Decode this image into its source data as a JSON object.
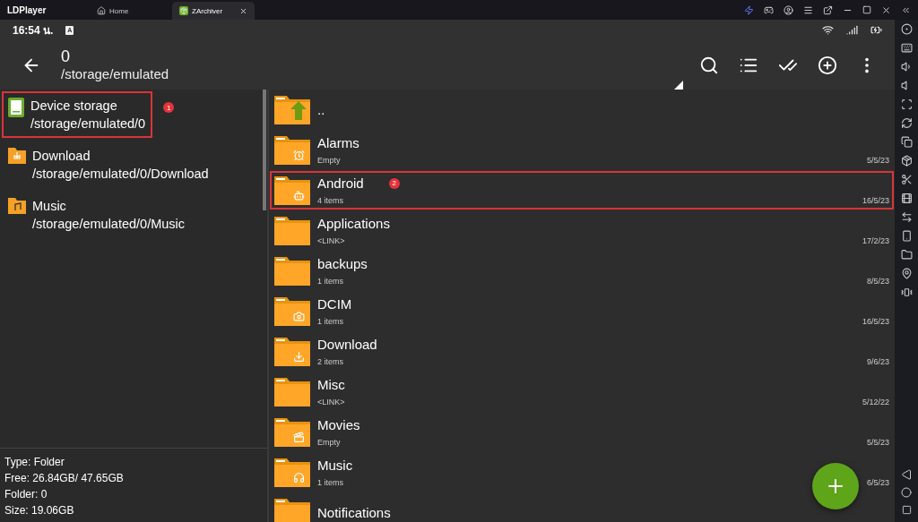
{
  "emulator": {
    "brand": "LDPlayer",
    "tabs": [
      {
        "label": "Home",
        "selected": false,
        "closable": false
      },
      {
        "label": "ZArchiver",
        "selected": true,
        "closable": true
      }
    ]
  },
  "status_bar": {
    "time": "16:54 น.",
    "notification": "A"
  },
  "toolbar": {
    "title": "0",
    "path": "/storage/emulated"
  },
  "sidebar": {
    "items": [
      {
        "kind": "storage",
        "name": "Device storage",
        "path": "/storage/emulated/0",
        "highlighted": true,
        "marker": "1"
      },
      {
        "kind": "download",
        "name": "Download",
        "path": "/storage/emulated/0/Download",
        "highlighted": false
      },
      {
        "kind": "music",
        "name": "Music",
        "path": "/storage/emulated/0/Music",
        "highlighted": false
      }
    ],
    "info": [
      "Type: Folder",
      "Free: 26.84GB/ 47.65GB",
      "Folder: 0",
      "Size: 19.06GB"
    ]
  },
  "files": [
    {
      "kind": "up",
      "name": "..",
      "highlighted": false
    },
    {
      "kind": "alarm",
      "name": "Alarms",
      "detail": "Empty",
      "date": "5/5/23",
      "highlighted": false
    },
    {
      "kind": "android",
      "name": "Android",
      "detail": "4 items",
      "date": "16/5/23",
      "highlighted": true,
      "marker": "2"
    },
    {
      "kind": "plain",
      "name": "Applications",
      "detail": "<LINK>",
      "date": "17/2/23",
      "highlighted": false
    },
    {
      "kind": "plain",
      "name": "backups",
      "detail": "1 items",
      "date": "8/5/23",
      "highlighted": false
    },
    {
      "kind": "camera",
      "name": "DCIM",
      "detail": "1 items",
      "date": "16/5/23",
      "highlighted": false
    },
    {
      "kind": "download",
      "name": "Download",
      "detail": "2 items",
      "date": "9/6/23",
      "highlighted": false
    },
    {
      "kind": "plain",
      "name": "Misc",
      "detail": "<LINK>",
      "date": "5/12/22",
      "highlighted": false
    },
    {
      "kind": "movie",
      "name": "Movies",
      "detail": "Empty",
      "date": "5/5/23",
      "highlighted": false
    },
    {
      "kind": "music",
      "name": "Music",
      "detail": "1 items",
      "date": "6/5/23",
      "highlighted": false
    },
    {
      "kind": "plain",
      "name": "Notifications",
      "highlighted": false
    }
  ]
}
